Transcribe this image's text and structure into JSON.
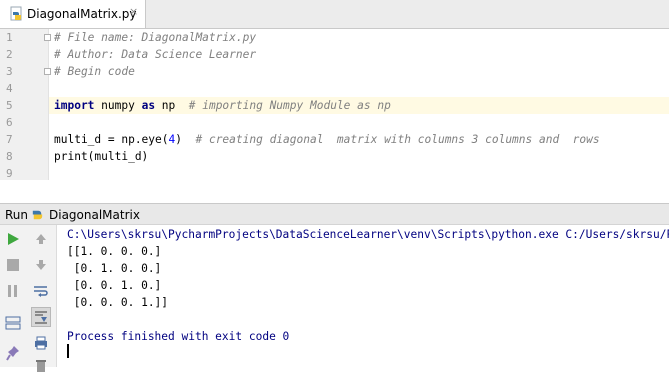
{
  "editor": {
    "tab": {
      "filename": "DiagonalMatrix.py",
      "close_glyph": "×"
    },
    "lines": [
      {
        "number": "1",
        "segments": [
          {
            "type": "comment",
            "text": "# File name: DiagonalMatrix.py"
          }
        ]
      },
      {
        "number": "2",
        "segments": [
          {
            "type": "comment",
            "text": "# Author: Data Science Learner"
          }
        ]
      },
      {
        "number": "3",
        "segments": [
          {
            "type": "comment",
            "text": "# Begin code"
          }
        ]
      },
      {
        "number": "4",
        "segments": []
      },
      {
        "number": "5",
        "current": true,
        "segments": [
          {
            "type": "keyword",
            "text": "import"
          },
          {
            "type": "plain",
            "text": " numpy "
          },
          {
            "type": "keyword",
            "text": "as"
          },
          {
            "type": "plain",
            "text": " np  "
          },
          {
            "type": "comment",
            "text": "# importing Numpy Module as np"
          }
        ]
      },
      {
        "number": "6",
        "segments": []
      },
      {
        "number": "7",
        "segments": [
          {
            "type": "plain",
            "text": "multi_d = np.eye("
          },
          {
            "type": "number",
            "text": "4"
          },
          {
            "type": "plain",
            "text": ")  "
          },
          {
            "type": "comment",
            "text": "# creating diagonal  matrix with columns 3 columns and  rows"
          }
        ]
      },
      {
        "number": "8",
        "segments": [
          {
            "type": "plain",
            "text": "print(multi_d)"
          }
        ]
      },
      {
        "number": "9",
        "segments": []
      }
    ]
  },
  "run_panel": {
    "title": "Run",
    "config_name": "DiagonalMatrix",
    "console": {
      "command": "C:\\Users\\skrsu\\PycharmProjects\\DataScienceLearner\\venv\\Scripts\\python.exe C:/Users/skrsu/P",
      "output": [
        "[[1. 0. 0. 0.]",
        " [0. 1. 0. 0.]",
        " [0. 0. 1. 0.]",
        " [0. 0. 0. 1.]]"
      ],
      "exit_message": "Process finished with exit code 0"
    }
  },
  "colors": {
    "comment": "#808080",
    "keyword": "#000080",
    "number": "#0000ff",
    "current_line": "#fffae3",
    "run_green": "#3fa83f"
  }
}
